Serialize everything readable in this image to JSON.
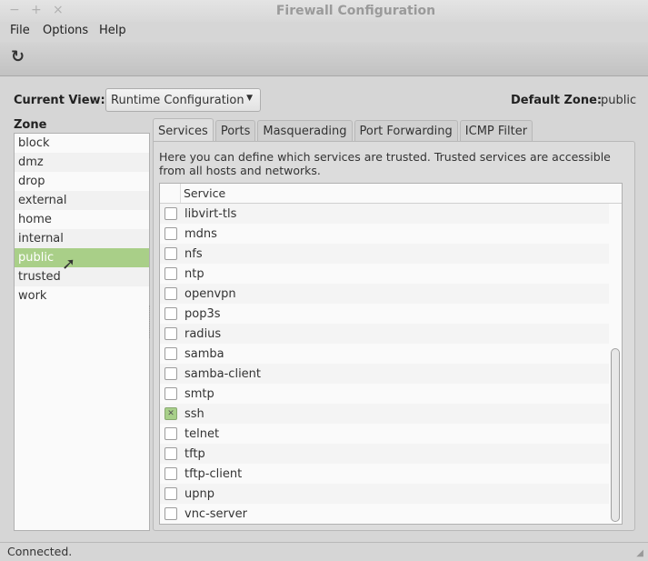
{
  "window": {
    "title": "Firewall Configuration",
    "controls": [
      "−",
      "+",
      "×"
    ]
  },
  "menu": [
    "File",
    "Options",
    "Help"
  ],
  "toolbar": {
    "reload_icon": "↻"
  },
  "view": {
    "label": "Current View:",
    "selected": "Runtime Configuration",
    "default_zone_label": "Default Zone:",
    "default_zone": "public"
  },
  "zones": {
    "label": "Zone",
    "items": [
      "block",
      "dmz",
      "drop",
      "external",
      "home",
      "internal",
      "public",
      "trusted",
      "work"
    ],
    "selected": "public"
  },
  "tabs": [
    "Services",
    "Ports",
    "Masquerading",
    "Port Forwarding",
    "ICMP Filter"
  ],
  "services": {
    "description": "Here you can define which services are trusted. Trusted services are accessible from all hosts and networks.",
    "column": "Service",
    "rows": [
      {
        "name": "libvirt-tls",
        "checked": false
      },
      {
        "name": "mdns",
        "checked": false
      },
      {
        "name": "nfs",
        "checked": false
      },
      {
        "name": "ntp",
        "checked": false
      },
      {
        "name": "openvpn",
        "checked": false
      },
      {
        "name": "pop3s",
        "checked": false
      },
      {
        "name": "radius",
        "checked": false
      },
      {
        "name": "samba",
        "checked": false
      },
      {
        "name": "samba-client",
        "checked": false
      },
      {
        "name": "smtp",
        "checked": false
      },
      {
        "name": "ssh",
        "checked": true
      },
      {
        "name": "telnet",
        "checked": false
      },
      {
        "name": "tftp",
        "checked": false
      },
      {
        "name": "tftp-client",
        "checked": false
      },
      {
        "name": "upnp",
        "checked": false
      },
      {
        "name": "vnc-server",
        "checked": false
      }
    ]
  },
  "status": "Connected.",
  "colors": {
    "selection": "#a9cf88"
  }
}
